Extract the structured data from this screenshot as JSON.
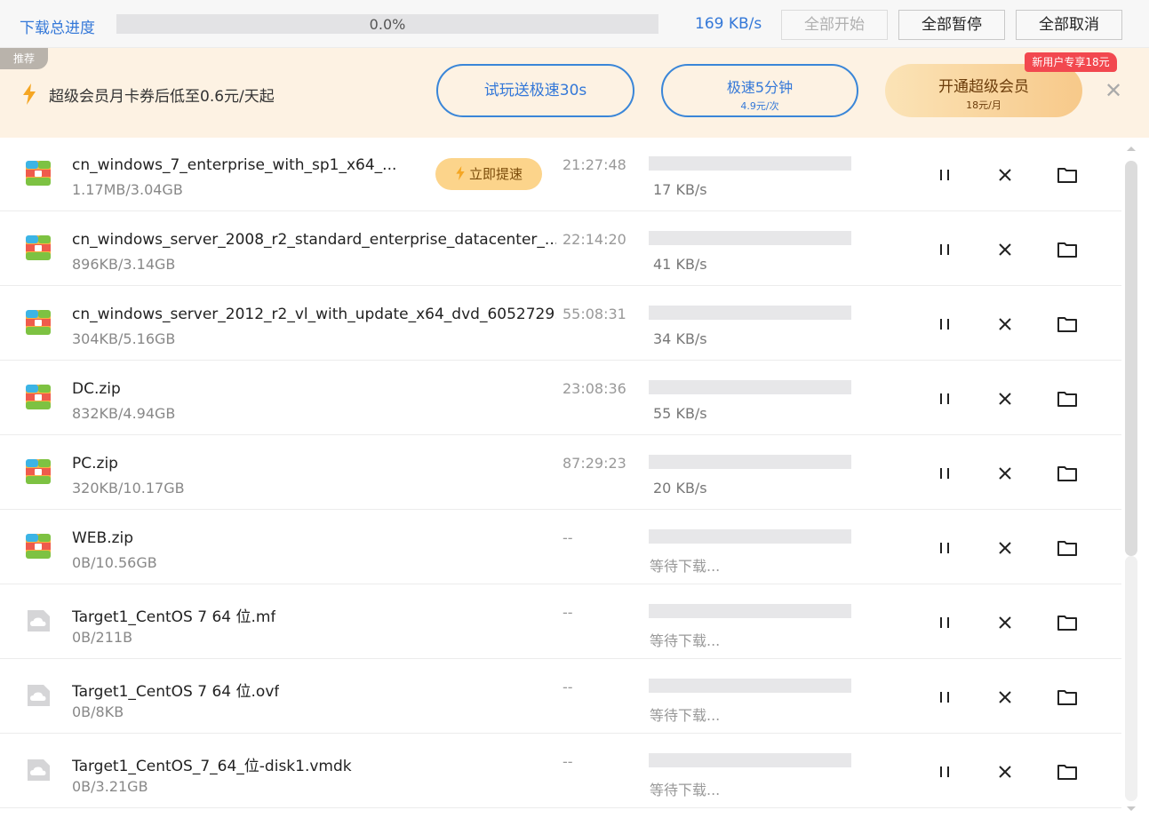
{
  "topbar": {
    "title": "下载总进度",
    "progress_pct": 0.0,
    "progress_label": "0.0%",
    "speed": "169 KB/s",
    "start_all": "全部开始",
    "pause_all": "全部暂停",
    "cancel_all": "全部取消"
  },
  "banner": {
    "tag": "推荐",
    "text": "超级会员月卡券后低至0.6元/天起",
    "trial_button": "试玩送极速30s",
    "speed_button_main": "极速5分钟",
    "speed_button_sub": "4.9元/次",
    "vip_button_main": "开通超级会员",
    "vip_button_sub": "18元/月",
    "vip_badge": "新用户专享18元",
    "close": "✕"
  },
  "colors": {
    "accent": "#3478d8",
    "banner_bg": "#fdf2e3",
    "boost_bg": "#fcd48b",
    "badge_red": "#f2484f"
  },
  "boost_label": "立即提速",
  "downloads": [
    {
      "name": "cn_windows_7_enterprise_with_sp1_x64_...",
      "size": "1.17MB/3.04GB",
      "time": "21:27:48",
      "status": "17 KB/s",
      "progress": 0.0,
      "icon": "archive-icon",
      "boost": true
    },
    {
      "name": "cn_windows_server_2008_r2_standard_enterprise_datacenter_...",
      "size": "896KB/3.14GB",
      "time": "22:14:20",
      "status": "41 KB/s",
      "progress": 0.0,
      "icon": "archive-icon",
      "boost": false
    },
    {
      "name": "cn_windows_server_2012_r2_vl_with_update_x64_dvd_6052729...",
      "size": "304KB/5.16GB",
      "time": "55:08:31",
      "status": "34 KB/s",
      "progress": 0.0,
      "icon": "archive-icon",
      "boost": false
    },
    {
      "name": "DC.zip",
      "size": "832KB/4.94GB",
      "time": "23:08:36",
      "status": "55 KB/s",
      "progress": 0.0,
      "icon": "archive-icon",
      "boost": false
    },
    {
      "name": "PC.zip",
      "size": "320KB/10.17GB",
      "time": "87:29:23",
      "status": "20 KB/s",
      "progress": 0.0,
      "icon": "archive-icon",
      "boost": false
    },
    {
      "name": "WEB.zip",
      "size": "0B/10.56GB",
      "time": "--",
      "status": "等待下载...",
      "progress": 0.0,
      "icon": "archive-icon",
      "boost": false
    },
    {
      "name": "Target1_CentOS 7 64 位.mf",
      "size": "0B/211B",
      "time": "--",
      "status": "等待下载...",
      "progress": 0.0,
      "icon": "cloud-file-icon",
      "boost": false
    },
    {
      "name": "Target1_CentOS 7 64 位.ovf",
      "size": "0B/8KB",
      "time": "--",
      "status": "等待下载...",
      "progress": 0.0,
      "icon": "cloud-file-icon",
      "boost": false
    },
    {
      "name": "Target1_CentOS_7_64_位-disk1.vmdk",
      "size": "0B/3.21GB",
      "time": "--",
      "status": "等待下载...",
      "progress": 0.0,
      "icon": "cloud-file-icon",
      "boost": false
    }
  ]
}
